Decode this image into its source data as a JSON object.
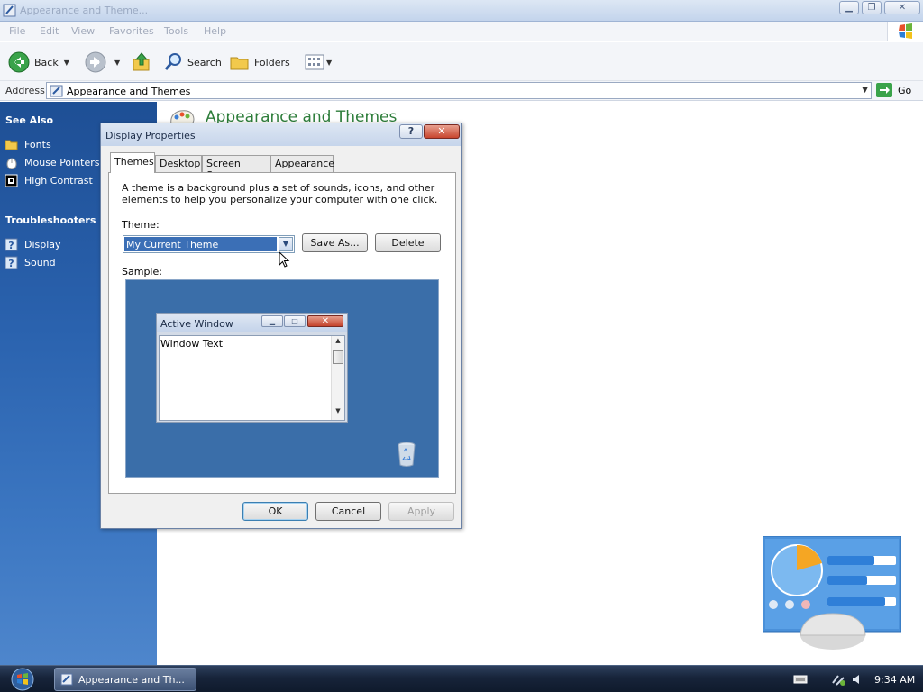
{
  "window": {
    "title": "Appearance and Theme...",
    "menu": [
      "File",
      "Edit",
      "View",
      "Favorites",
      "Tools",
      "Help"
    ],
    "toolbar": {
      "back_label": "Back",
      "search_label": "Search",
      "folders_label": "Folders"
    },
    "address": {
      "label": "Address",
      "value": "Appearance and Themes",
      "go_label": "Go"
    }
  },
  "sidebar": {
    "see_also_heading": "See Also",
    "see_also_items": [
      {
        "label": "Fonts",
        "icon": "folder-icon"
      },
      {
        "label": "Mouse Pointers",
        "icon": "mouse-icon"
      },
      {
        "label": "High Contrast",
        "icon": "contrast-icon"
      }
    ],
    "troubleshooters_heading": "Troubleshooters",
    "troubleshooters_items": [
      {
        "label": "Display",
        "icon": "help-icon"
      },
      {
        "label": "Sound",
        "icon": "help-icon"
      }
    ]
  },
  "content": {
    "title": "Appearance and Themes"
  },
  "dialog": {
    "title": "Display Properties",
    "help_label": "?",
    "tabs": [
      "Themes",
      "Desktop",
      "Screen Saver",
      "Appearance"
    ],
    "active_tab": "Themes",
    "description": "A theme is a background plus a set of sounds, icons, and other elements to help you personalize your computer with one click.",
    "theme_label": "Theme:",
    "theme_value": "My Current Theme",
    "save_as_label": "Save As...",
    "delete_label": "Delete",
    "sample_label": "Sample:",
    "sample_window": {
      "title": "Active Window",
      "text": "Window Text"
    },
    "ok_label": "OK",
    "cancel_label": "Cancel",
    "apply_label": "Apply"
  },
  "taskbar": {
    "task_label": "Appearance and Th...",
    "clock": "9:34 AM"
  },
  "colors": {
    "sidebar_blue": "#2a62ae",
    "content_title_green": "#2d7d3a",
    "sample_desktop": "#3a6ea9",
    "selection_blue": "#3b6fb6"
  }
}
